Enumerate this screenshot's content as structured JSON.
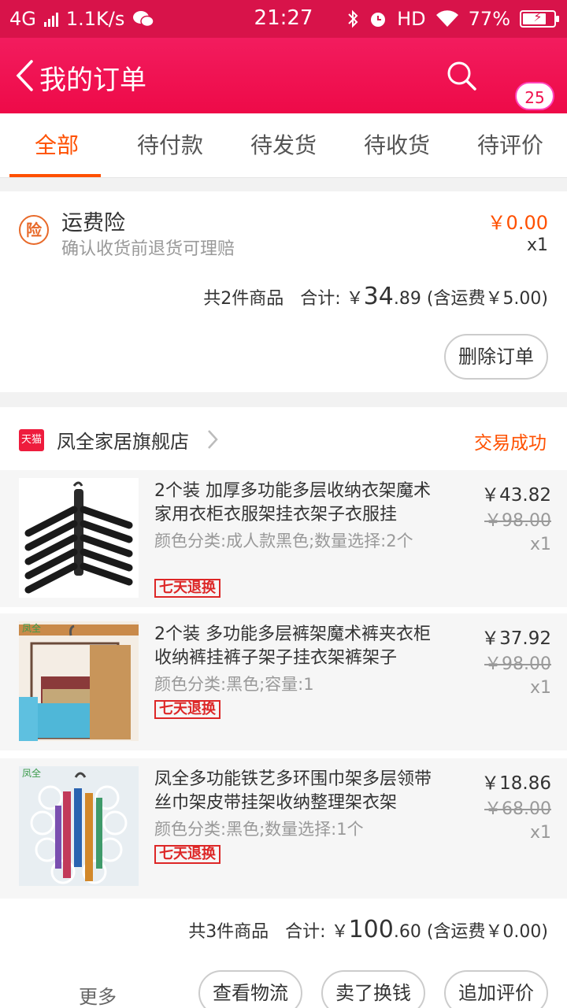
{
  "status_bar": {
    "network": "4G",
    "speed": "1.1K/s",
    "time": "21:27",
    "hd": "HD",
    "battery": "77%",
    "battery_level": 0.77,
    "icons": [
      "signal-icon",
      "wechat-icon",
      "bluetooth-icon",
      "alarm-icon",
      "wifi-icon",
      "battery-icon"
    ]
  },
  "header": {
    "title": "我的订单",
    "badge": "25",
    "icons": [
      "back-arrow-icon",
      "search-icon",
      "more-vertical-icon"
    ]
  },
  "tabs": [
    {
      "label": "全部",
      "active": true
    },
    {
      "label": "待付款",
      "active": false
    },
    {
      "label": "待发货",
      "active": false
    },
    {
      "label": "待收货",
      "active": false
    },
    {
      "label": "待评价",
      "active": false
    }
  ],
  "order1": {
    "insurance": {
      "icon_text": "险",
      "title": "运费险",
      "subtitle": "确认收货前退货可理赔",
      "price": "￥0.00",
      "qty": "x1"
    },
    "summary": {
      "count": "共2件商品",
      "total_label": "合计: ￥",
      "total_int": "34",
      "total_dec": ".89",
      "shipping": "(含运费￥5.00)"
    },
    "delete_button": "删除订单"
  },
  "order2": {
    "shop_badge": "天猫",
    "shop_name": "凤全家居旗舰店",
    "status": "交易成功",
    "items": [
      {
        "title": "2个装 加厚多功能多层收纳衣架魔术家用衣柜衣服架挂衣架子衣服挂",
        "spec": "颜色分类:成人款黑色;数量选择:2个",
        "tag": "七天退换",
        "price": "￥43.82",
        "original_price": "￥98.00",
        "qty": "x1"
      },
      {
        "title": "2个装 多功能多层裤架魔术裤夹衣柜收纳裤挂裤子架子挂衣架裤架子",
        "spec": "颜色分类:黑色;容量:1",
        "tag": "七天退换",
        "price": "￥37.92",
        "original_price": "￥98.00",
        "qty": "x1",
        "image_label": "凤全"
      },
      {
        "title": "凤全多功能铁艺多环围巾架多层领带丝巾架皮带挂架收纳整理架衣架",
        "spec": "颜色分类:黑色;数量选择:1个",
        "tag": "七天退换",
        "price": "￥18.86",
        "original_price": "￥68.00",
        "qty": "x1",
        "image_label": "凤全"
      }
    ],
    "summary": {
      "count": "共3件商品",
      "total_label": "合计: ￥",
      "total_int": "100",
      "total_dec": ".60",
      "shipping": "(含运费￥0.00)"
    },
    "actions": {
      "more": "更多",
      "logistics": "查看物流",
      "resell": "卖了换钱",
      "review": "追加评价"
    }
  },
  "colors": {
    "accent": "#ff5000",
    "header": "#ee0a48",
    "tag_red": "#dd2727"
  }
}
